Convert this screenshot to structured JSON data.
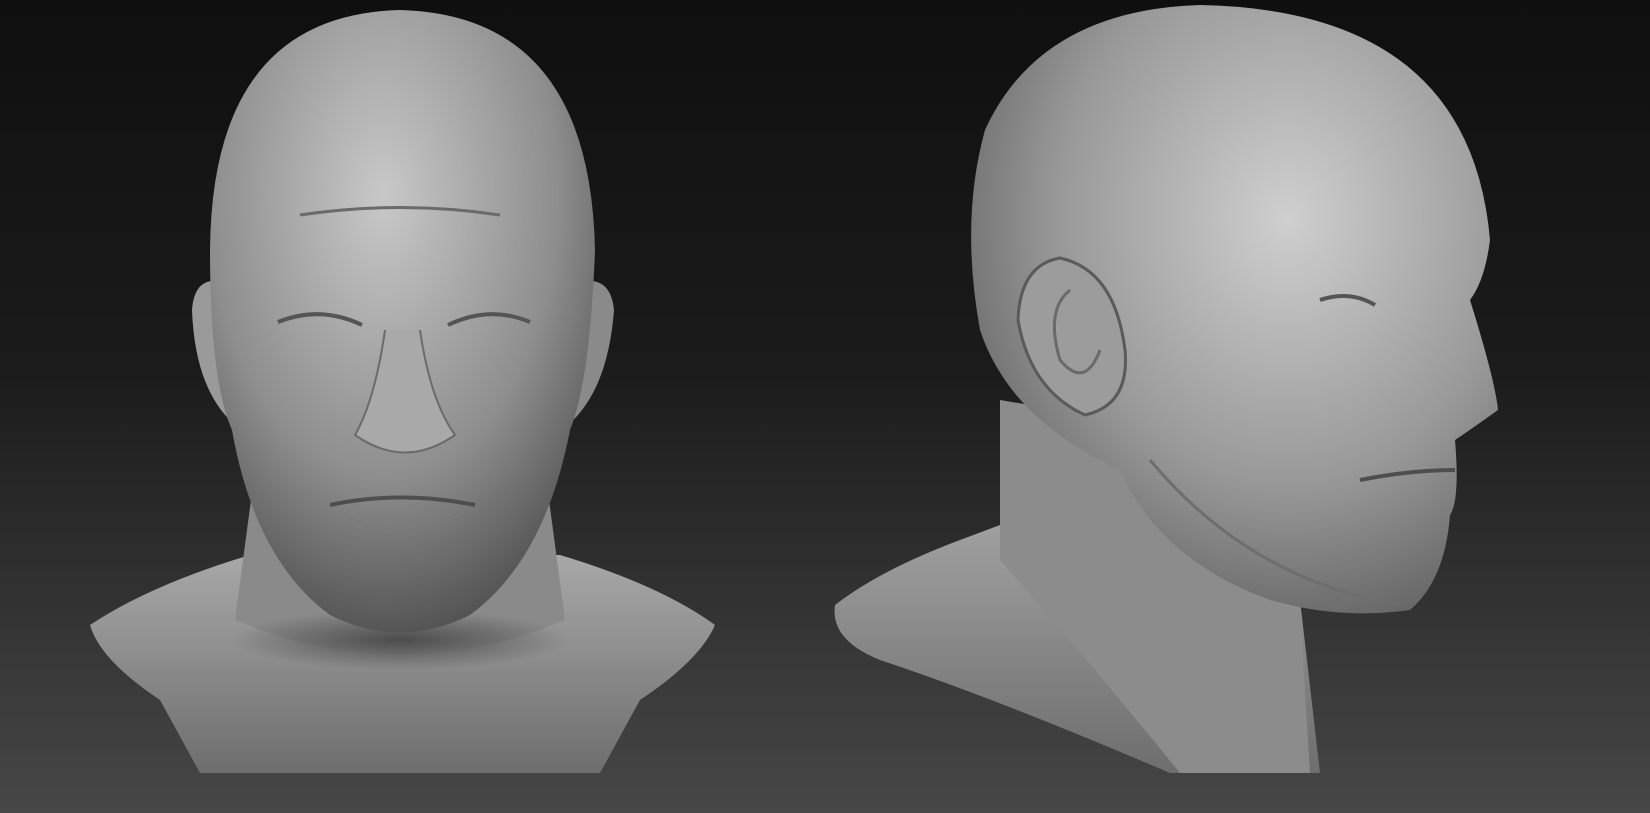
{
  "scene": {
    "figure_count": 2,
    "colors": {
      "background_top": "#0f0f0f",
      "background_bottom": "#474747",
      "sculpt_light": "#c8c8c8",
      "sculpt_mid": "#8e8e8e",
      "sculpt_dark": "#4a4a4a"
    }
  }
}
